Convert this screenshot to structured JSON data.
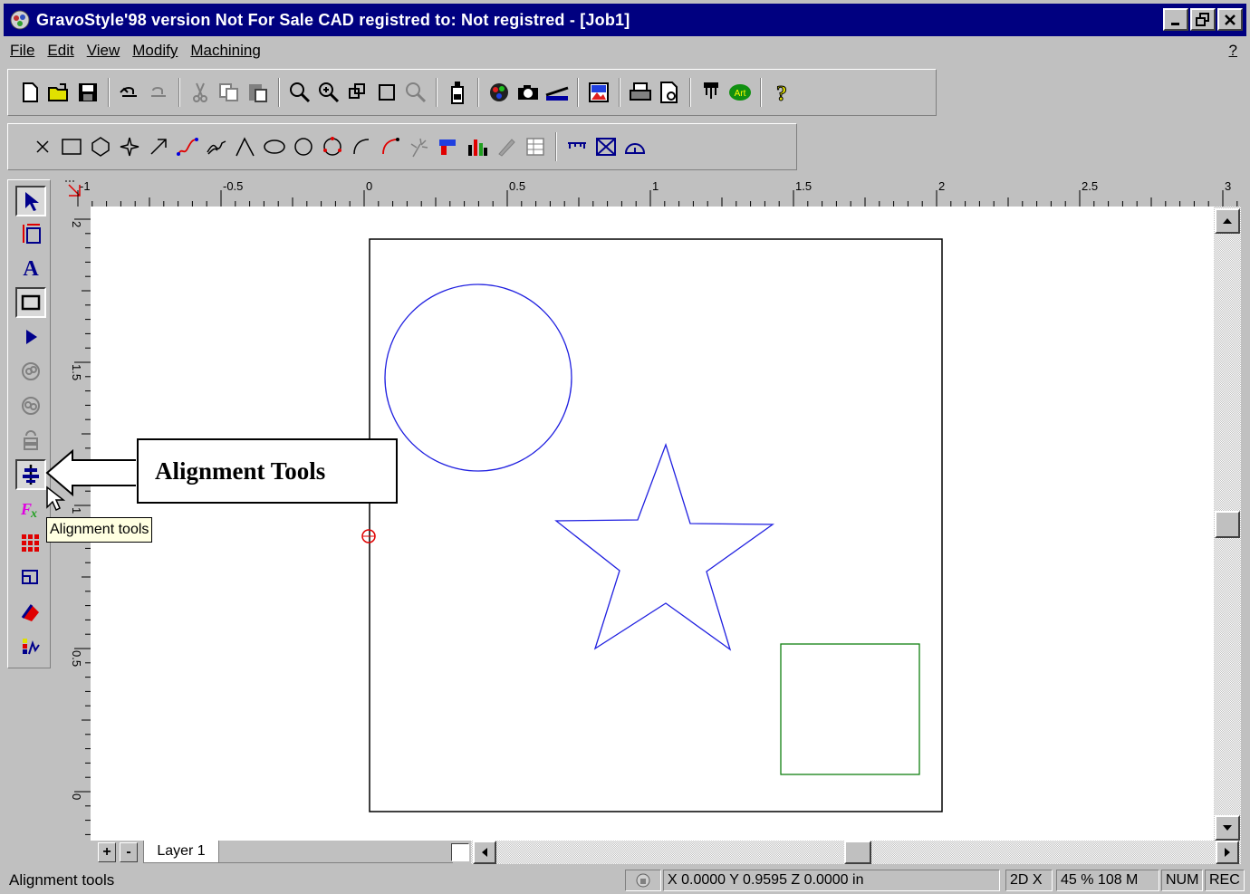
{
  "window": {
    "title": "GravoStyle'98  version Not For Sale CAD registred to: Not registred  - [Job1]"
  },
  "menu": {
    "items": [
      "File",
      "Edit",
      "View",
      "Modify",
      "Machining"
    ],
    "help": "?"
  },
  "toolbar_main": {
    "icons": [
      "new-file-icon",
      "open-folder-icon",
      "save-icon",
      "undo-icon",
      "redo-icon",
      "cut-icon",
      "copy-icon",
      "paste-icon",
      "zoom-icon",
      "zoom-in-icon",
      "zoom-window-icon",
      "zoom-page-icon",
      "zoom-previous-icon",
      "bottle-icon",
      "color-palette-icon",
      "camera-icon",
      "scanner-icon",
      "image-icon",
      "print-icon",
      "print-preview-icon",
      "engrave-tool-icon",
      "art-icon",
      "help-icon"
    ]
  },
  "toolbar_draw": {
    "icons": [
      "point-icon",
      "rectangle-icon",
      "polygon-icon",
      "star-icon",
      "arrow-line-icon",
      "bezier-icon",
      "freehand-icon",
      "polyline-icon",
      "ellipse-icon",
      "circle-icon",
      "circle-3pts-icon",
      "arc-icon",
      "arc-red-icon",
      "sparkle-icon",
      "drill-icon",
      "bar-chart-icon",
      "pen-icon",
      "table-icon",
      "dimension-icon",
      "frame-icon",
      "protractor-icon"
    ]
  },
  "left_toolbar": {
    "icons": [
      "select-arrow-icon",
      "node-edit-icon",
      "text-tool-icon",
      "shape-tool-icon",
      "small-arrow-icon",
      "weld-icon",
      "break-icon",
      "stack-icon",
      "alignment-tools-icon",
      "fx-icon",
      "grid-icon",
      "frame-tool-icon",
      "fill-icon",
      "color-bars-icon"
    ]
  },
  "rulers": {
    "horizontal_labels": [
      "-1",
      "-0.5",
      "0",
      "0.5",
      "1",
      "1.5",
      "2",
      "2.5",
      "3"
    ],
    "vertical_labels": [
      "2",
      "1.5",
      "1",
      "0.5",
      "0"
    ]
  },
  "layer": {
    "add": "+",
    "remove": "-",
    "name": "Layer 1"
  },
  "callout": {
    "text": "Alignment Tools"
  },
  "tooltip": {
    "text": "Alignment tools"
  },
  "status": {
    "message": "Alignment tools",
    "coords": "X 0.0000   Y 0.9595   Z 0.0000 in",
    "mode": "2D X",
    "zoom": "45 % 108 M",
    "num": "NUM",
    "rec": "REC"
  },
  "colors": {
    "title_bg": "#000080",
    "circle": "#2020e0",
    "star": "#2020e0",
    "square": "#108010",
    "marker": "#e00000"
  }
}
